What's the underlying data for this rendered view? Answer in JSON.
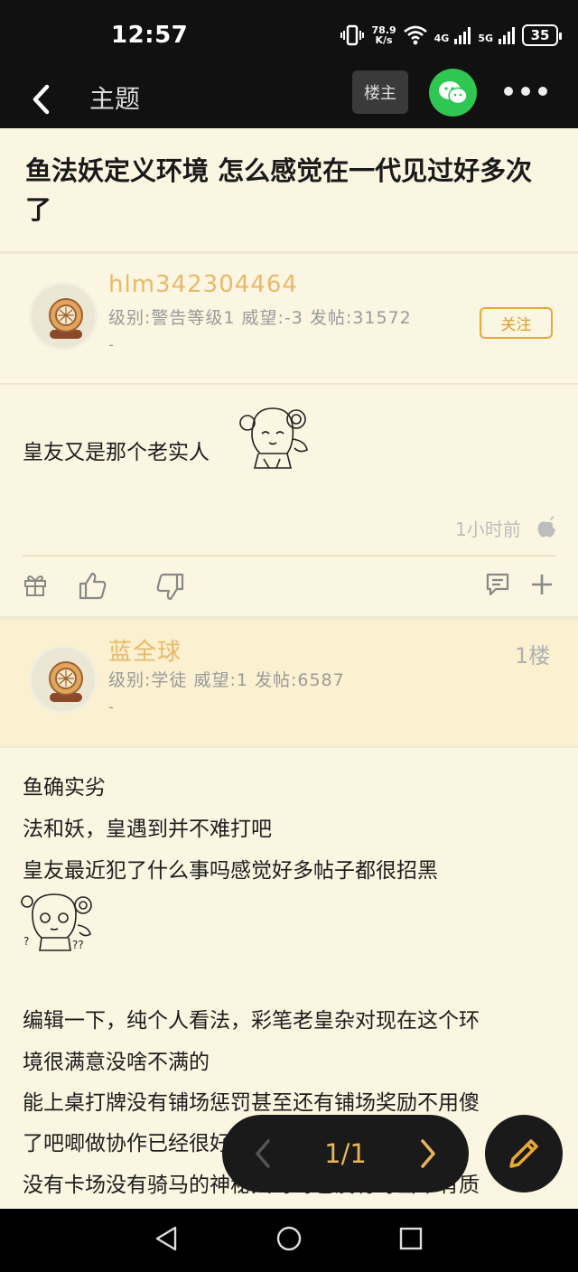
{
  "status_bar": {
    "time": "12:57",
    "speed_top": "78.9",
    "speed_unit": "K/s",
    "net1": "4G",
    "net2": "5G",
    "battery": "35"
  },
  "nav": {
    "title": "主题",
    "louzhu_label": "楼主",
    "icons": [
      "back-icon",
      "wechat-icon",
      "more-icon"
    ]
  },
  "topic": {
    "title": "鱼法妖定义环境 怎么感觉在一代见过好多次了"
  },
  "post1": {
    "username": "hlm342304464",
    "meta": "级别:警告等级1 威望:-3 发帖:31572",
    "dash": "-",
    "follow_label": "关注",
    "content": "皇友又是那个老实人",
    "time": "1小时前"
  },
  "post2": {
    "username": "蓝全球",
    "floor": "1楼",
    "meta": "级别:学徒 威望:1 发帖:6587",
    "dash": "-",
    "lines": [
      "鱼确实劣",
      "法和妖，皇遇到并不难打吧",
      "皇友最近犯了什么事吗感觉好多帖子都很招黑",
      "编辑一下，纯个人看法，彩笔老皇杂对现在这个环",
      "境很满意没啥不满的",
      "能上桌打牌没有铺场惩罚甚至还有铺场奖励不用傻",
      "了吧唧做协作已经很好了",
      "没有卡场没有骑马的神秘大哥哥也没有每当带有质"
    ]
  },
  "pager": {
    "label": "1/1"
  },
  "colors": {
    "accent": "#e8b45a",
    "background": "#fbf6e1",
    "wechat": "#2fc651"
  }
}
